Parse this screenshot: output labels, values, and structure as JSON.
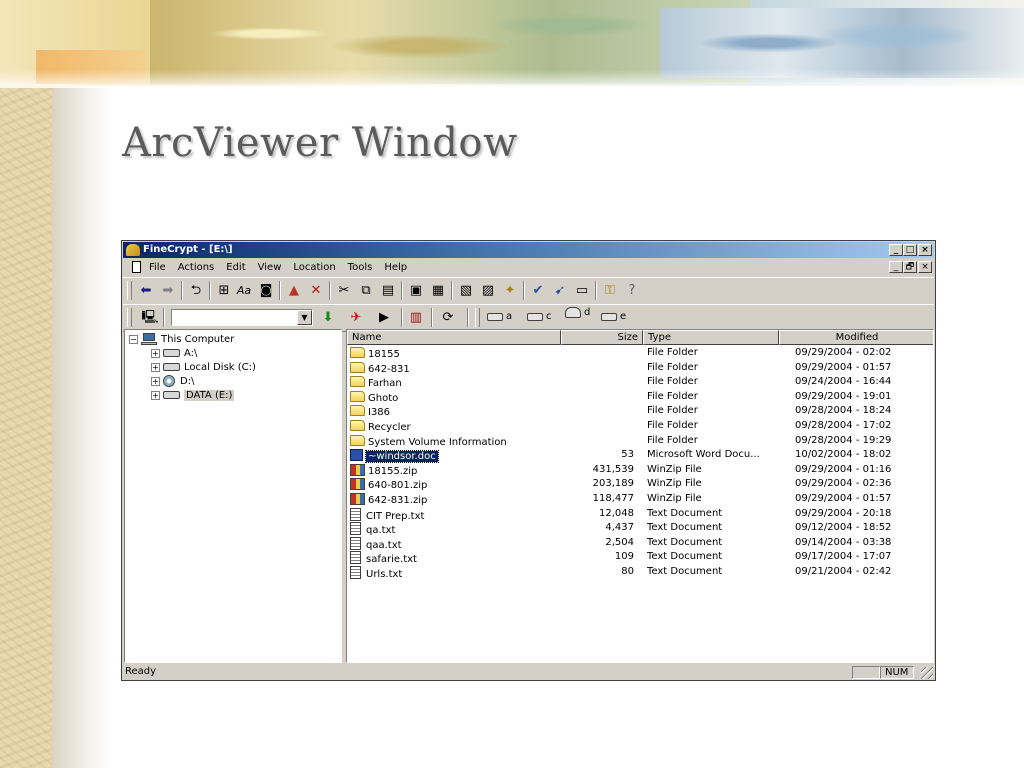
{
  "slide": {
    "title": "ArcViewer Window"
  },
  "window": {
    "title": "FineCrypt - [E:\\]",
    "controls": {
      "minimize": "_",
      "maximize": "□",
      "close": "×",
      "restore": "🗗"
    }
  },
  "menu": [
    "File",
    "Actions",
    "Edit",
    "View",
    "Location",
    "Tools",
    "Help"
  ],
  "toolbar1": [
    "back-arrow-icon",
    "forward-arrow-icon",
    "up-folder-icon",
    "tree-view-icon",
    "rename-icon",
    "properties-icon",
    "encrypt-icon",
    "delete-icon",
    "cut-icon",
    "copy-icon",
    "paste-icon",
    "new-folder-icon",
    "folder-properties-icon",
    "compress-icon",
    "extract-icon",
    "options-icon",
    "check-icon",
    "sign-icon",
    "view-icon",
    "key-icon",
    "help-icon"
  ],
  "toolbar2": {
    "path_value": "",
    "drives": [
      {
        "label": "a",
        "icon": "floppy-drive-icon"
      },
      {
        "label": "c",
        "icon": "hard-drive-icon"
      },
      {
        "label": "d",
        "icon": "cd-drive-icon"
      },
      {
        "label": "e",
        "icon": "hard-drive-icon"
      }
    ]
  },
  "tree": {
    "root": "This Computer",
    "items": [
      {
        "label": "A:\\",
        "icon": "floppy-drive-icon"
      },
      {
        "label": "Local Disk (C:)",
        "icon": "hard-drive-icon"
      },
      {
        "label": "D:\\",
        "icon": "cd-drive-icon"
      },
      {
        "label": "DATA (E:)",
        "icon": "hard-drive-icon",
        "selected": true
      }
    ]
  },
  "list": {
    "columns": [
      "Name",
      "Size",
      "Type",
      "Modified"
    ],
    "rows": [
      {
        "name": "18155",
        "size": "",
        "type": "File Folder",
        "modified": "09/29/2004 - 02:02",
        "icon": "folder"
      },
      {
        "name": "642-831",
        "size": "",
        "type": "File Folder",
        "modified": "09/29/2004 - 01:57",
        "icon": "folder"
      },
      {
        "name": "Farhan",
        "size": "",
        "type": "File Folder",
        "modified": "09/24/2004 - 16:44",
        "icon": "folder"
      },
      {
        "name": "Ghoto",
        "size": "",
        "type": "File Folder",
        "modified": "09/29/2004 - 19:01",
        "icon": "folder"
      },
      {
        "name": "I386",
        "size": "",
        "type": "File Folder",
        "modified": "09/28/2004 - 18:24",
        "icon": "folder"
      },
      {
        "name": "Recycler",
        "size": "",
        "type": "File Folder",
        "modified": "09/28/2004 - 17:02",
        "icon": "folder"
      },
      {
        "name": "System Volume Information",
        "size": "",
        "type": "File Folder",
        "modified": "09/28/2004 - 19:29",
        "icon": "folder"
      },
      {
        "name": "~windsor.doc",
        "size": "53",
        "type": "Microsoft Word Docu...",
        "modified": "10/02/2004 - 18:02",
        "icon": "doc",
        "selected": true
      },
      {
        "name": "18155.zip",
        "size": "431,539",
        "type": "WinZip File",
        "modified": "09/29/2004 - 01:16",
        "icon": "zip"
      },
      {
        "name": "640-801.zip",
        "size": "203,189",
        "type": "WinZip File",
        "modified": "09/29/2004 - 02:36",
        "icon": "zip"
      },
      {
        "name": "642-831.zip",
        "size": "118,477",
        "type": "WinZip File",
        "modified": "09/29/2004 - 01:57",
        "icon": "zip"
      },
      {
        "name": "CIT Prep.txt",
        "size": "12,048",
        "type": "Text Document",
        "modified": "09/29/2004 - 20:18",
        "icon": "txt"
      },
      {
        "name": "qa.txt",
        "size": "4,437",
        "type": "Text Document",
        "modified": "09/12/2004 - 18:52",
        "icon": "txt"
      },
      {
        "name": "qaa.txt",
        "size": "2,504",
        "type": "Text Document",
        "modified": "09/14/2004 - 03:38",
        "icon": "txt"
      },
      {
        "name": "safarie.txt",
        "size": "109",
        "type": "Text Document",
        "modified": "09/17/2004 - 17:07",
        "icon": "txt"
      },
      {
        "name": "Urls.txt",
        "size": "80",
        "type": "Text Document",
        "modified": "09/21/2004 - 02:42",
        "icon": "txt"
      }
    ]
  },
  "status": {
    "text": "Ready",
    "num": "NUM"
  }
}
